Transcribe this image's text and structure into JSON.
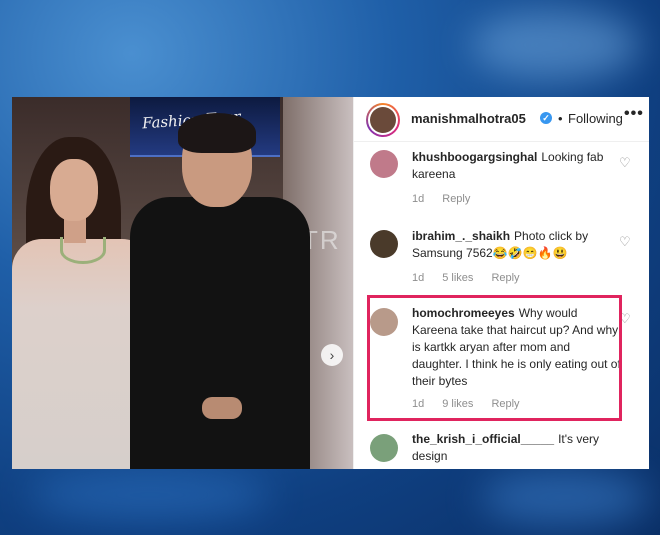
{
  "post": {
    "photo_sign_text": "Fashion Tour",
    "photo_wall_text": "TR",
    "next_icon": "chevron-right-icon"
  },
  "header": {
    "username": "manishmalhotra05",
    "verified_icon": "verified-badge-icon",
    "separator": "•",
    "follow_status": "Following",
    "more_icon": "ellipsis-icon",
    "more_glyph": "•••"
  },
  "comments": [
    {
      "username": "khushboogargsinghal",
      "text": "Looking fab kareena",
      "time": "1d",
      "likes": "",
      "reply": "Reply",
      "avatar_color": "#c07a8a"
    },
    {
      "username": "ibrahim_._shaikh",
      "text": "Photo click by Samsung 7562😂🤣😁🔥😃",
      "time": "1d",
      "likes": "5 likes",
      "reply": "Reply",
      "avatar_color": "#4a3a2a"
    },
    {
      "username": "homochromeeyes",
      "text": "Why would Kareena take that haircut up? And why is kartkk aryan after mom and daughter. I think he is only eating out of their bytes",
      "time": "1d",
      "likes": "9 likes",
      "reply": "Reply",
      "avatar_color": "#b89a8a"
    },
    {
      "username": "the_krish_i_official_____",
      "text": "It's very design",
      "time": "",
      "likes": "",
      "reply": "",
      "avatar_color": "#7aa07a"
    }
  ],
  "icons": {
    "heart": "heart-icon",
    "heart_glyph": "♡"
  },
  "colors": {
    "highlight": "#e0245e",
    "verified": "#3897f0"
  }
}
